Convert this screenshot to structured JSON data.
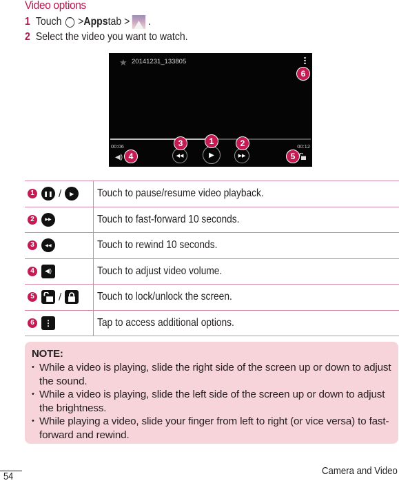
{
  "section_title": "Video options",
  "steps": [
    {
      "num": "1",
      "pre": "Touch",
      "mid": "> ",
      "bold": "Apps",
      "post": " tab >",
      "end": "."
    },
    {
      "num": "2",
      "text": "Select the video you want to watch."
    }
  ],
  "player": {
    "file_name": "20141231_133805",
    "time_elapsed": "00:06",
    "time_total": "00:12",
    "progress_percent": 50,
    "badges": [
      "1",
      "2",
      "3",
      "4",
      "5",
      "6"
    ]
  },
  "options": [
    {
      "num": "1",
      "icons": [
        "pause-icon",
        "play-icon"
      ],
      "text": "Touch to pause/resume video playback."
    },
    {
      "num": "2",
      "icons": [
        "fast-forward-icon"
      ],
      "text": "Touch to fast-forward 10 seconds."
    },
    {
      "num": "3",
      "icons": [
        "rewind-icon"
      ],
      "text": "Touch to rewind 10 seconds."
    },
    {
      "num": "4",
      "icons": [
        "volume-icon"
      ],
      "text": "Touch to adjust video volume."
    },
    {
      "num": "5",
      "icons": [
        "unlock-icon",
        "lock-icon"
      ],
      "text": "Touch to lock/unlock the screen."
    },
    {
      "num": "6",
      "icons": [
        "more-options-icon"
      ],
      "text": "Tap to access additional options."
    }
  ],
  "note": {
    "title": "NOTE:",
    "items": [
      "While a video is playing, slide the right side of the screen up or down to adjust the sound.",
      "While a video is playing, slide the left side of the screen up or down to adjust the brightness.",
      "While playing a video, slide your finger from left to right (or vice versa) to fast-forward and rewind."
    ]
  },
  "footer": {
    "page_number": "54",
    "chapter": "Camera and Video"
  },
  "colors": {
    "accent": "#b5164b",
    "badge": "#c41c52",
    "note_bg": "#f7d3da",
    "rule": "#d4899f"
  }
}
